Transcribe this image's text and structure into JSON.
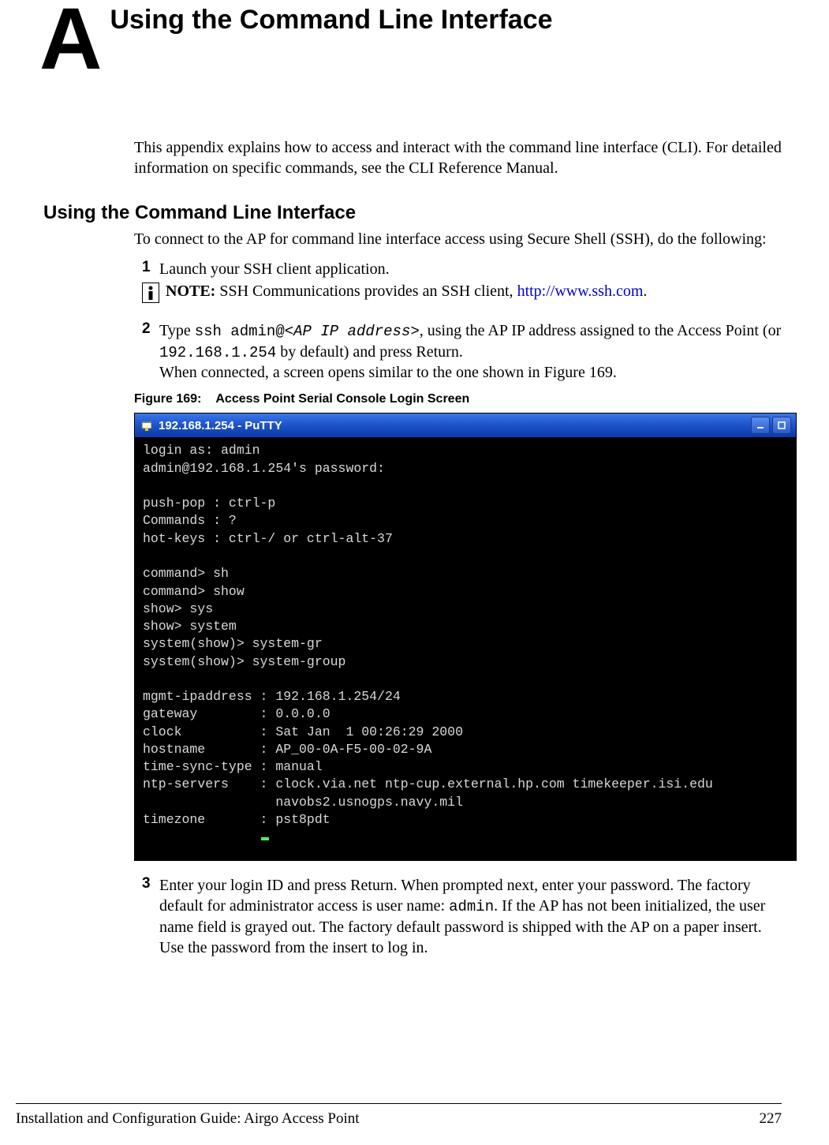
{
  "header": {
    "appendix_letter": "A",
    "chapter_title": "Using the Command Line Interface"
  },
  "intro": "This appendix explains how to access and interact with the command line interface (CLI). For detailed information on specific commands, see the CLI Reference Manual.",
  "section_heading": "Using the Command Line Interface",
  "section_intro": "To connect to the AP for command line interface access using Secure Shell (SSH), do the following:",
  "steps": {
    "s1": {
      "num": "1",
      "text": "Launch your SSH client application."
    },
    "note": {
      "bold": "NOTE:",
      "text_before_link": " SSH Communications provides an SSH client, ",
      "link": "http://www.ssh.com",
      "text_after_link": "."
    },
    "s2": {
      "num": "2",
      "pre": "Type ",
      "cmd_prefix": "ssh admin@",
      "cmd_arg": "<AP IP address>",
      "mid": ", using the AP IP address assigned to the Access Point (or ",
      "ip": "192.168.1.254",
      "post": " by default) and press Return.",
      "sub": "When connected, a screen opens similar to the one shown in Figure 169."
    },
    "s3": {
      "num": "3",
      "text_a": "Enter your login ID and press Return. When prompted next, enter your password. The factory default for administrator access is user name: ",
      "admin": "admin",
      "text_b": ". If the AP has not been initialized, the user name field is grayed out. The factory default password is shipped with the AP on a paper insert. Use the password from the insert to log in."
    }
  },
  "figure": {
    "num": "Figure 169:",
    "title": "Access Point Serial Console Login Screen"
  },
  "terminal": {
    "title": "192.168.1.254 - PuTTY",
    "lines": [
      "login as: admin",
      "admin@192.168.1.254's password:",
      "",
      "push-pop : ctrl-p",
      "Commands : ?",
      "hot-keys : ctrl-/ or ctrl-alt-37",
      "",
      "command> sh",
      "command> show",
      "show> sys",
      "show> system",
      "system(show)> system-gr",
      "system(show)> system-group",
      "",
      "mgmt-ipaddress : 192.168.1.254/24",
      "gateway        : 0.0.0.0",
      "clock          : Sat Jan  1 00:26:29 2000",
      "hostname       : AP_00-0A-F5-00-02-9A",
      "time-sync-type : manual",
      "ntp-servers    : clock.via.net ntp-cup.external.hp.com timekeeper.isi.edu",
      "                 navobs2.usnogps.navy.mil",
      "timezone       : pst8pdt"
    ]
  },
  "footer": {
    "left": "Installation and Configuration Guide: Airgo Access Point",
    "right": "227"
  }
}
